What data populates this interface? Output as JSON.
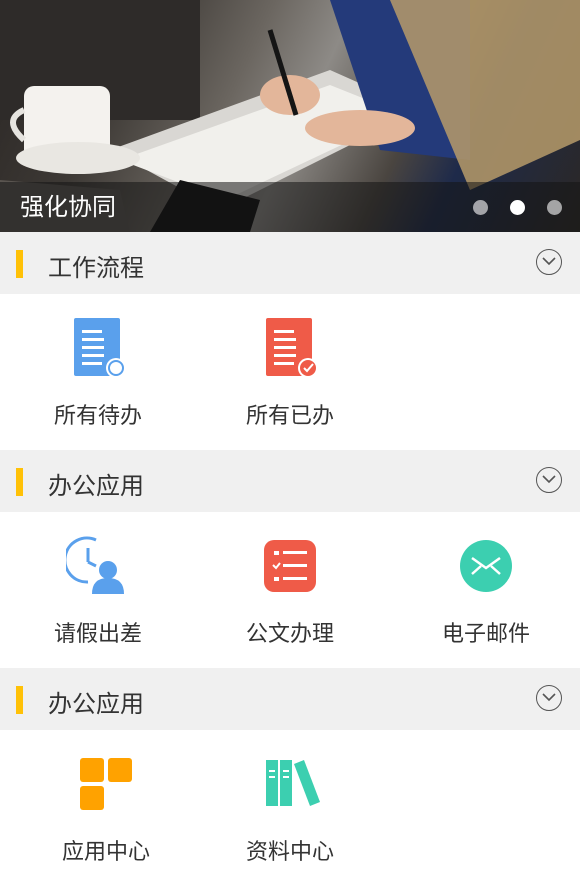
{
  "banner": {
    "caption": "强化协同",
    "pages": 3,
    "active_page": 2
  },
  "sections": [
    {
      "title": "工作流程",
      "items": [
        {
          "label": "所有待办",
          "icon": "pending-document-icon",
          "color": "#5aa0ec"
        },
        {
          "label": "所有已办",
          "icon": "done-document-icon",
          "color": "#ef5b48"
        }
      ]
    },
    {
      "title": "办公应用",
      "items": [
        {
          "label": "请假出差",
          "icon": "leave-clock-user-icon",
          "color": "#5aa0ec"
        },
        {
          "label": "公文办理",
          "icon": "document-list-icon",
          "color": "#ef5b48"
        },
        {
          "label": "电子邮件",
          "icon": "mail-icon",
          "color": "#3ccfb0"
        }
      ]
    },
    {
      "title": "办公应用",
      "items": [
        {
          "label": "应用中心",
          "icon": "app-center-icon",
          "color": "#ffa200"
        },
        {
          "label": "资料中心",
          "icon": "library-books-icon",
          "color": "#3ccfb0"
        }
      ]
    }
  ],
  "colors": {
    "accent_bar": "#ffc107",
    "section_bg": "#f0f0f0"
  }
}
